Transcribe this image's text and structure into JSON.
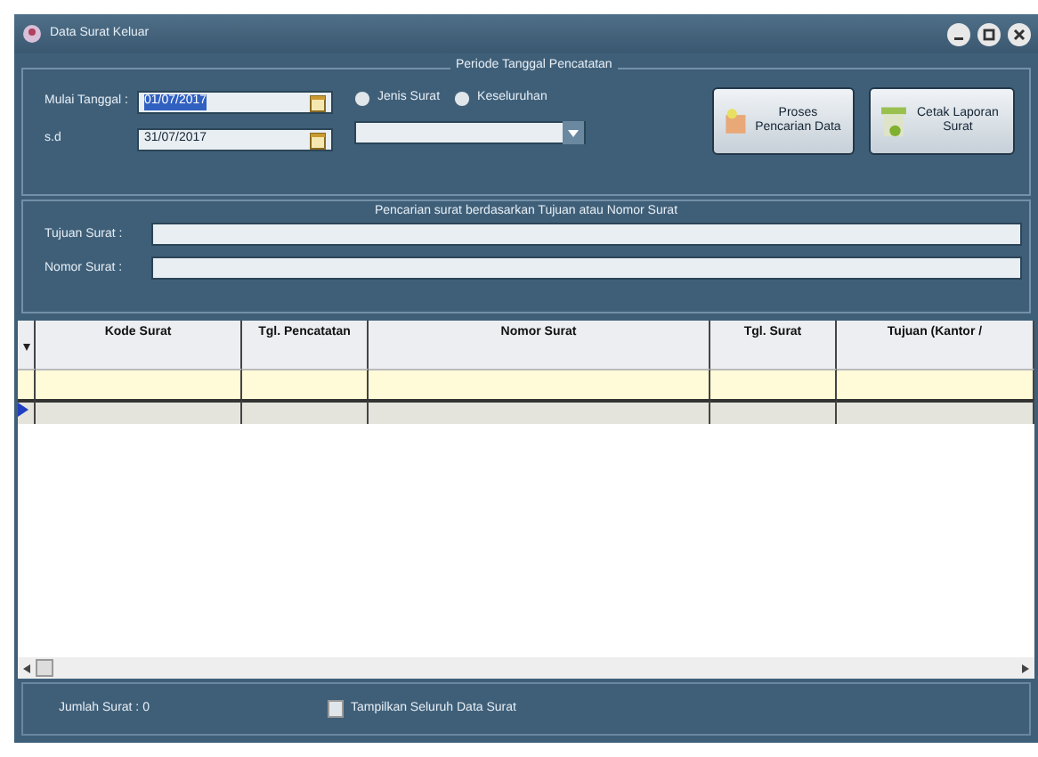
{
  "window": {
    "title": "Data Surat Keluar"
  },
  "period": {
    "legend": "Periode Tanggal Pencatatan",
    "from_label": "Mulai Tanggal :",
    "from_value": "01/07/2017",
    "to_label": "s.d",
    "to_value": "31/07/2017"
  },
  "options": [
    {
      "label": "Jenis Surat",
      "selected": false
    },
    {
      "label": "Keseluruhan",
      "selected": false
    }
  ],
  "buttons": [
    {
      "label": "Proses Pencarian Data",
      "kind": "search"
    },
    {
      "label": "Cetak Laporan Surat",
      "kind": "print"
    }
  ],
  "search": {
    "legend": "Pencarian surat berdasarkan Tujuan atau Nomor Surat",
    "fields": [
      {
        "label": "Tujuan Surat :"
      },
      {
        "label": "Nomor Surat :"
      }
    ]
  },
  "table": {
    "columns": [
      "Kode Surat",
      "Tgl. Pencatatan",
      "Nomor Surat",
      "Tgl. Surat",
      "Tujuan (Kantor /"
    ]
  },
  "status_bar": {
    "count": "Jumlah Surat : 0",
    "show_all": {
      "label": "Tampilkan Seluruh Data Surat",
      "checked": false
    }
  }
}
